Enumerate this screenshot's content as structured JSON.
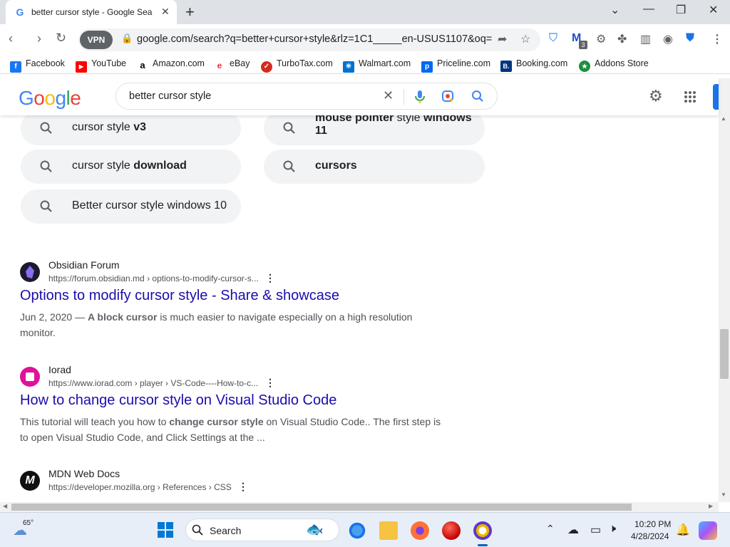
{
  "browser": {
    "tab_title": "better cursor style - Google Sea",
    "tab_favicon": "G",
    "url": "google.com/search?q=better+cursor+style&rlz=1C1_____en-USUS1107&oq=b...",
    "vpn_label": "VPN",
    "extension_badge": "3"
  },
  "bookmarks": [
    {
      "label": "Facebook",
      "icon": "facebook-icon",
      "color": "#1877f2",
      "glyph": "f"
    },
    {
      "label": "YouTube",
      "icon": "youtube-icon",
      "color": "#ff0000",
      "glyph": "▶"
    },
    {
      "label": "Amazon.com",
      "icon": "amazon-icon",
      "color": "#ffffff",
      "glyph": "a"
    },
    {
      "label": "eBay",
      "icon": "ebay-icon",
      "color": "#ffffff",
      "glyph": "e"
    },
    {
      "label": "TurboTax.com",
      "icon": "turbotax-icon",
      "color": "#d52b1e",
      "glyph": "✓"
    },
    {
      "label": "Walmart.com",
      "icon": "walmart-icon",
      "color": "#0071ce",
      "glyph": "✳"
    },
    {
      "label": "Priceline.com",
      "icon": "priceline-icon",
      "color": "#0068ef",
      "glyph": "p"
    },
    {
      "label": "Booking.com",
      "icon": "booking-icon",
      "color": "#003580",
      "glyph": "B."
    },
    {
      "label": "Addons Store",
      "icon": "addons-icon",
      "color": "#1e8e3e",
      "glyph": "★"
    }
  ],
  "google": {
    "query": "better cursor style"
  },
  "related_searches": [
    {
      "plain": "cursor style ",
      "bold": "v3",
      "bold_first": false
    },
    {
      "plain": "",
      "bold": "mouse pointer",
      "mid": " style ",
      "bold2": "windows 11",
      "bold_first": true
    },
    {
      "plain": "cursor style ",
      "bold": "download",
      "bold_first": false
    },
    {
      "plain": "",
      "bold": "cursors",
      "bold_first": true
    },
    {
      "plain": "Better cursor style windows 10",
      "bold": "",
      "bold_first": false
    }
  ],
  "results": [
    {
      "site": "Obsidian Forum",
      "url": "https://forum.obsidian.md › options-to-modify-cursor-s...",
      "title": "Options to modify cursor style - Share & showcase",
      "snippet_date": "Jun 2, 2020 — ",
      "snippet_bold": "A block cursor",
      "snippet_rest": " is much easier to navigate especially on a high resolution monitor.",
      "icon": "obsidian-icon"
    },
    {
      "site": "Iorad",
      "url": "https://www.iorad.com › player › VS-Code----How-to-c...",
      "title": "How to change cursor style on Visual Studio Code",
      "snippet_pre": "This tutorial will teach you how to ",
      "snippet_bold": "change cursor style",
      "snippet_rest": " on Visual Studio Code.. The first step is to open Visual Studio Code, and Click Settings at the ...",
      "icon": "iorad-icon"
    },
    {
      "site": "MDN Web Docs",
      "url": "https://developer.mozilla.org › References › CSS",
      "icon": "mdn-icon"
    }
  ],
  "taskbar": {
    "weather_temp": "65°",
    "search_label": "Search",
    "time": "10:20 PM",
    "date": "4/28/2024"
  }
}
